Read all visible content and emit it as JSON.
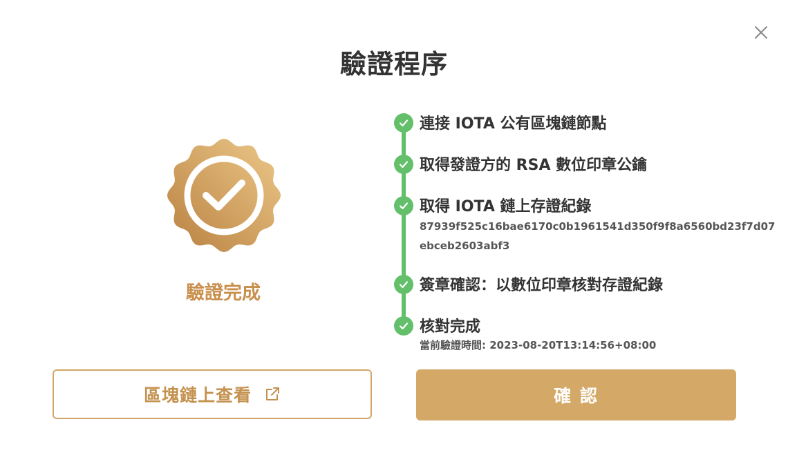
{
  "dialog": {
    "title": "驗證程序",
    "close_icon": "close-icon"
  },
  "result": {
    "label": "驗證完成",
    "badge_icon": "verified-badge-icon",
    "badge_color": "#c98f4c"
  },
  "steps": [
    {
      "label": "連接 IOTA 公有區塊鏈節點",
      "status": "done"
    },
    {
      "label": "取得發證方的 RSA 數位印章公鑰",
      "status": "done"
    },
    {
      "label": "取得 IOTA 鏈上存證紀錄",
      "status": "done",
      "hash_line1": "87939f525c16bae6170c0b1961541d350f9f8a6560bd23f7d07",
      "hash_line2": "ebceb2603abf3"
    },
    {
      "label": "簽章確認：以數位印章核對存證紀錄",
      "status": "done"
    },
    {
      "label": "核對完成",
      "status": "done",
      "detail": "當前驗證時間: 2023-08-20T13:14:56+08:00"
    }
  ],
  "buttons": {
    "view_on_chain": "區塊鏈上查看",
    "view_icon": "external-link-icon",
    "confirm": "確 認"
  },
  "colors": {
    "accent": "#d4a867",
    "success": "#63bf6a",
    "text": "#333333"
  }
}
